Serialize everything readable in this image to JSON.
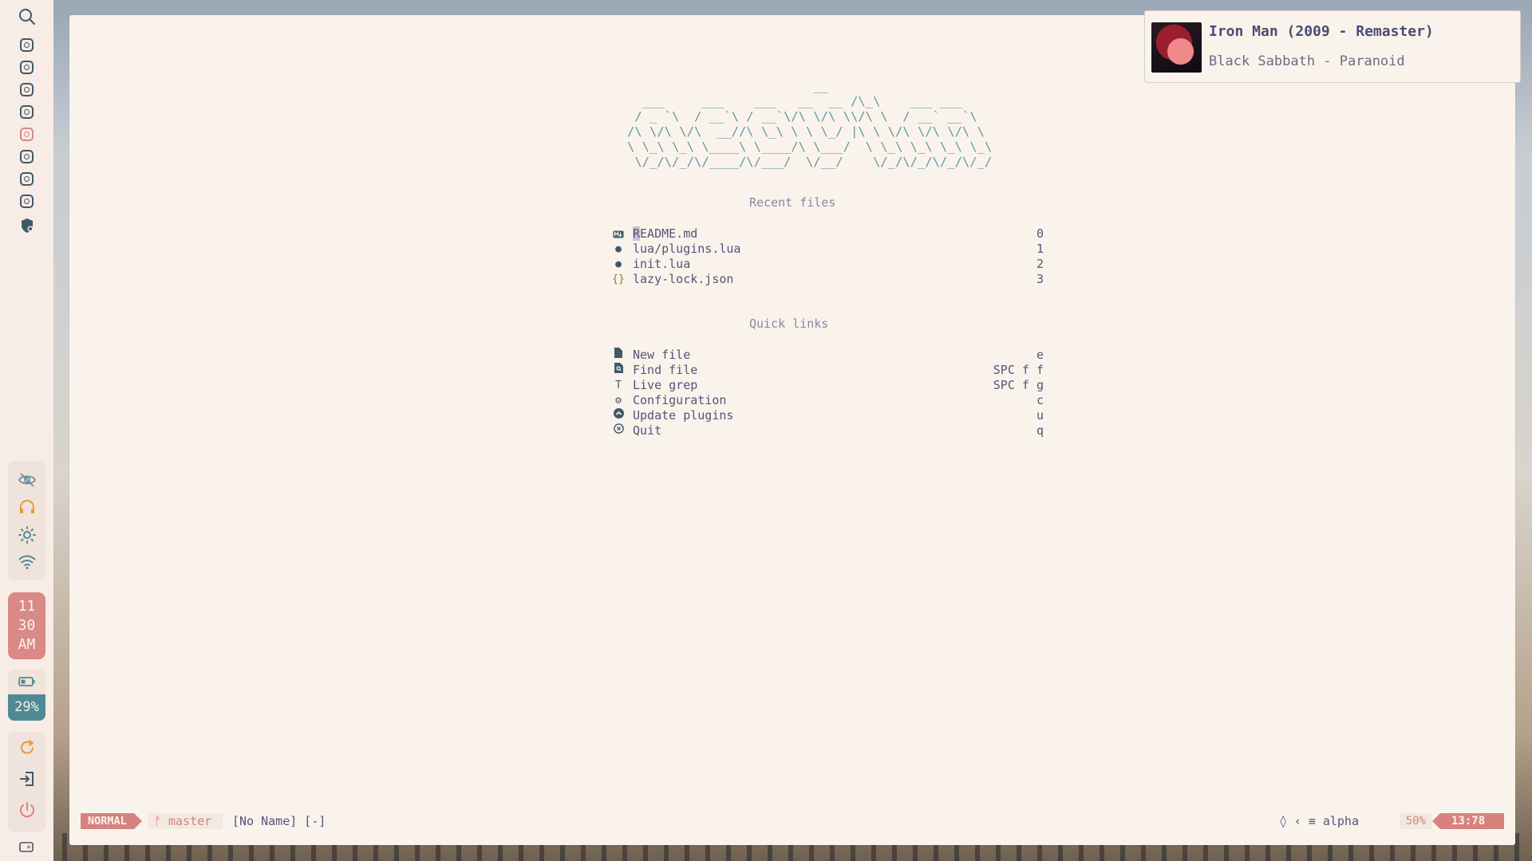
{
  "sidebar": {
    "workspaces": [
      "workspace-1",
      "workspace-2",
      "workspace-3",
      "workspace-4",
      "workspace-5",
      "workspace-6",
      "workspace-7",
      "workspace-8"
    ],
    "active_workspace": 5,
    "clock": {
      "hour": "11",
      "minute": "30",
      "ampm": "AM"
    },
    "battery": {
      "percent_label": "29%"
    }
  },
  "now_playing": {
    "title": "Iron Man (2009 - Remaster)",
    "artist_album": "Black Sabbath - Paranoid"
  },
  "dashboard": {
    "recent_title": "Recent files",
    "recent_files": [
      {
        "icon": "markdown-icon",
        "name": "README.md",
        "key": "0"
      },
      {
        "icon": "lua-icon",
        "name": "lua/plugins.lua",
        "key": "1"
      },
      {
        "icon": "lua-icon",
        "name": "init.lua",
        "key": "2"
      },
      {
        "icon": "json-icon",
        "name": "lazy-lock.json",
        "key": "3"
      }
    ],
    "quick_title": "Quick links",
    "quick_links": [
      {
        "icon": "file-icon",
        "name": "New file",
        "key": "e"
      },
      {
        "icon": "file-search-icon",
        "name": "Find file",
        "key": "SPC f f"
      },
      {
        "icon": "text-icon",
        "name": "Live grep",
        "key": "SPC f g"
      },
      {
        "icon": "gear-icon",
        "name": "Configuration",
        "key": "c"
      },
      {
        "icon": "arrow-up-circle-icon",
        "name": "Update plugins",
        "key": "u"
      },
      {
        "icon": "close-circle-icon",
        "name": "Quit",
        "key": "q"
      }
    ]
  },
  "statusline": {
    "mode": "NORMAL",
    "branch": "master",
    "buffer": "[No Name] [-]",
    "filetype": "alpha",
    "percent": "50%",
    "position": "13:78"
  },
  "colors": {
    "accent": "#d7827e",
    "teal": "#4f8a94",
    "foreground": "#575279",
    "background": "#faf3ec"
  }
}
